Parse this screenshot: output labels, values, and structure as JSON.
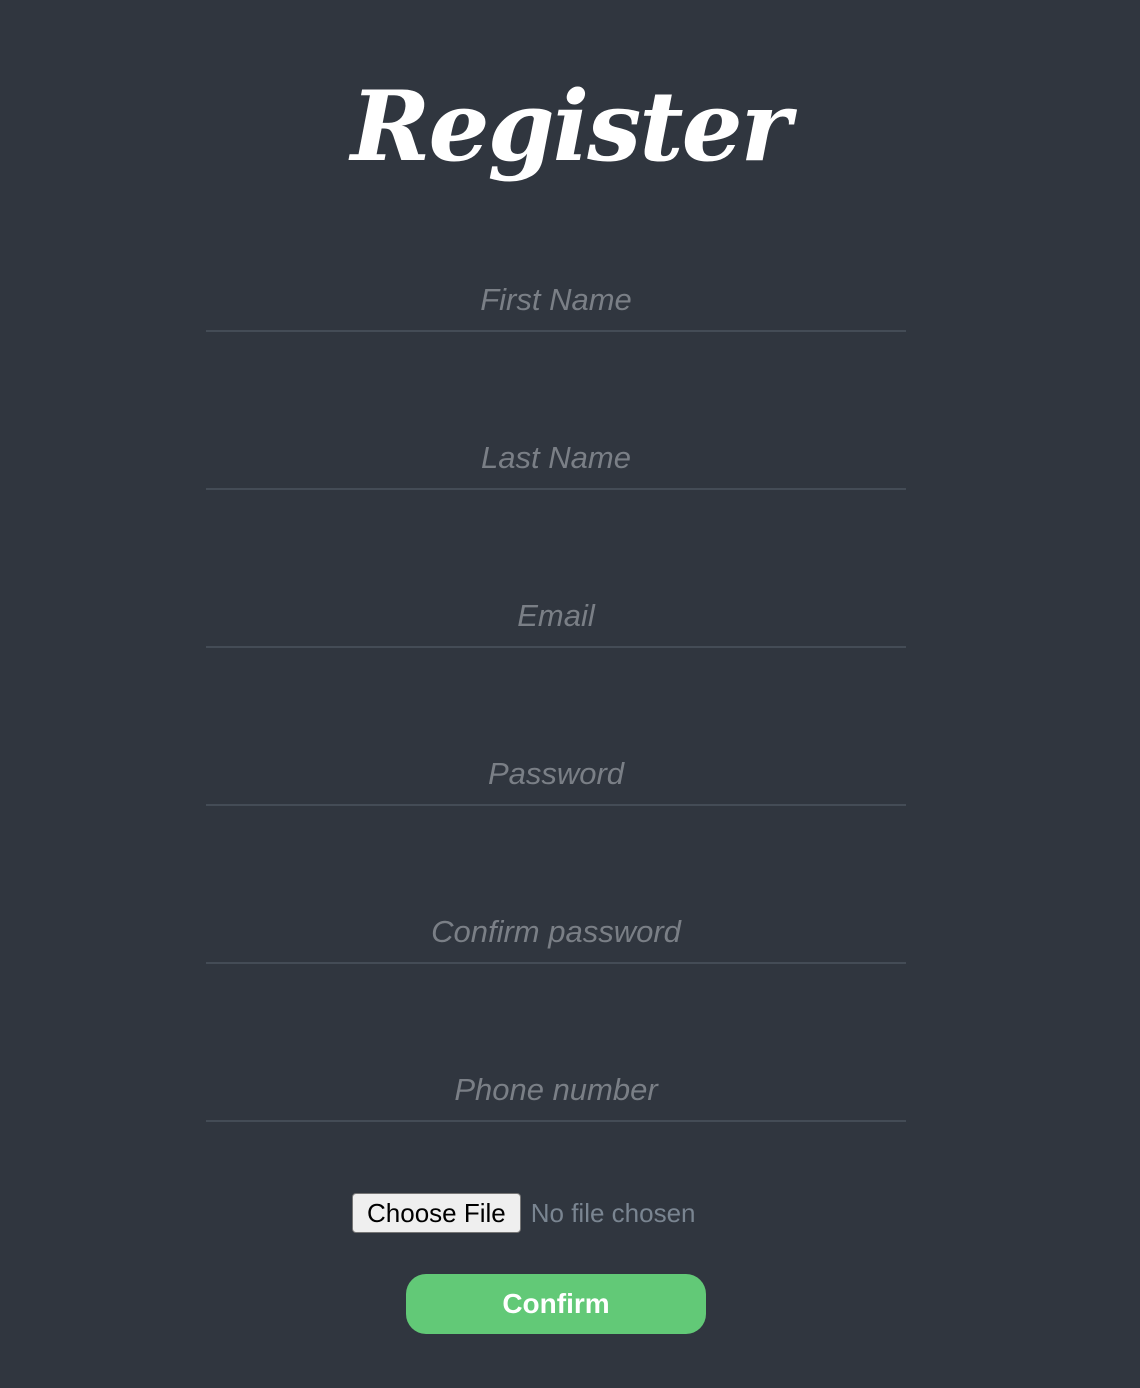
{
  "page": {
    "title": "Register"
  },
  "form": {
    "fields": [
      {
        "placeholder": "First Name",
        "value": ""
      },
      {
        "placeholder": "Last Name",
        "value": ""
      },
      {
        "placeholder": "Email",
        "value": ""
      },
      {
        "placeholder": "Password",
        "value": ""
      },
      {
        "placeholder": "Confirm password",
        "value": ""
      },
      {
        "placeholder": "Phone number",
        "value": ""
      }
    ],
    "file_upload": {
      "button_label": "Choose File",
      "status": "No file chosen"
    },
    "confirm_label": "Confirm"
  },
  "colors": {
    "background": "#30363f",
    "accent": "#62c977",
    "placeholder": "#7a7f86",
    "underline": "#444c56"
  }
}
